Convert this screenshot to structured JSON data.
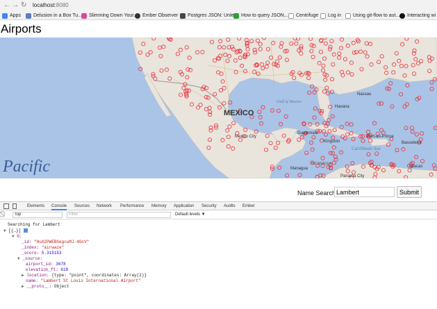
{
  "browser": {
    "url_host": "localhost",
    "url_port": ":8080",
    "bookmarks": [
      {
        "label": "Apps",
        "color": "#4285f4"
      },
      {
        "label": "Delusion in a Box Tu...",
        "color": "#5a7fbf"
      },
      {
        "label": "Slimming Down Your...",
        "color": "#d04ba0"
      },
      {
        "label": "Ember Observer",
        "color": "#333333"
      },
      {
        "label": "Postgres JSON: Unle...",
        "color": "#444444"
      },
      {
        "label": "How to query JSON...",
        "color": "#2e9e3b"
      },
      {
        "label": "Centrifuge",
        "color": "#888888"
      },
      {
        "label": "Log in",
        "color": "#888888"
      },
      {
        "label": "Using git-flow to aut...",
        "color": "#888888"
      },
      {
        "label": "Interacting wi",
        "color": "#111111"
      }
    ]
  },
  "page": {
    "title": "Airports"
  },
  "map": {
    "labels": {
      "mexico": "MEXICO",
      "mexico_city": "Mexico City",
      "gulf": "Gulf of Mexico",
      "havana": "Havana",
      "nassau": "Nassau",
      "caribbean": "Caribbean Sea",
      "pacific": "Pacific",
      "guatemala": "Guatemala",
      "managua": "Managua",
      "panama_city": "Panama City",
      "caracas": "Caracas",
      "kingston": "Kingston",
      "prince": "Port-au-Prince",
      "basseterre": "Basseterre",
      "nicaragua": "NICARAGUA"
    },
    "colors": {
      "ocean": "#a9c4e6",
      "land": "#e9e4dc",
      "marker": "#e8323c"
    }
  },
  "search": {
    "label": "Name Search",
    "value": "Lambert",
    "submit_label": "Submit"
  },
  "devtools": {
    "tabs": [
      "Elements",
      "Console",
      "Sources",
      "Network",
      "Performance",
      "Memory",
      "Application",
      "Security",
      "Audits",
      "Ember"
    ],
    "active_tab": "Console",
    "context": "top",
    "filter_placeholder": "Filter",
    "levels": "Default levels ▼",
    "console": {
      "line1": "Searching for Lambert",
      "line2": "[{…}]",
      "line3": "0:",
      "id_key": "_id:",
      "id_val": "\"HuX2PWEBSegcuMJ-4GcV\"",
      "index_key": "_index:",
      "index_val": "\"airwaze\"",
      "score_key": "_score:",
      "score_val": "5.315153",
      "source_key": "_source:",
      "airport_id_key": "airport_id:",
      "airport_id_val": "3678",
      "elevation_key": "elevation_ft:",
      "elevation_val": "618",
      "location_key": "location:",
      "location_val": "{type: \"point\", coordinates: Array(2)}",
      "name_key": "name:",
      "name_val": "\"Lambert St Louis International Airport\"",
      "proto_key": "__proto__:",
      "proto_val": "Object"
    }
  }
}
